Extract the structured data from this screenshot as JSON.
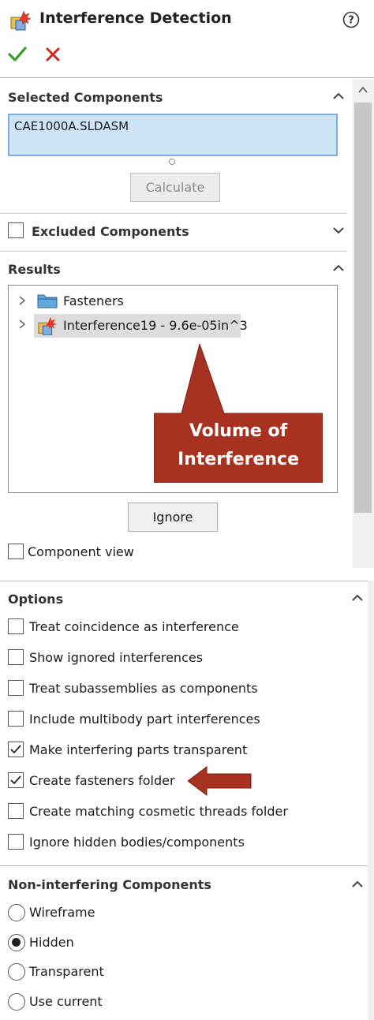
{
  "header": {
    "title": "Interference Detection",
    "help_icon": "help-circle-icon",
    "ok_icon": "checkmark-icon",
    "cancel_icon": "x-icon"
  },
  "selected_components": {
    "label": "Selected Components",
    "item": "CAE1000A.SLDASM",
    "calculate_label": "Calculate"
  },
  "excluded_components": {
    "label": "Excluded Components",
    "checked": false
  },
  "results": {
    "label": "Results",
    "tree": [
      {
        "label": "Fasteners",
        "icon": "folder-icon"
      },
      {
        "label": "Interference19 - 9.6e-05in^3",
        "icon": "interference-icon",
        "highlighted": true
      }
    ],
    "callout_line1": "Volume of",
    "callout_line2": "Interference",
    "ignore_label": "Ignore",
    "component_view_label": "Component view"
  },
  "options": {
    "label": "Options",
    "items": [
      {
        "label": "Treat coincidence as interference",
        "checked": false
      },
      {
        "label": "Show ignored interferences",
        "checked": false
      },
      {
        "label": "Treat subassemblies as components",
        "checked": false
      },
      {
        "label": "Include multibody part interferences",
        "checked": false
      },
      {
        "label": "Make interfering parts transparent",
        "checked": true
      },
      {
        "label": "Create fasteners folder",
        "checked": true
      },
      {
        "label": "Create matching cosmetic threads folder",
        "checked": false
      },
      {
        "label": "Ignore hidden bodies/components",
        "checked": false
      }
    ]
  },
  "non_interfering": {
    "label": "Non-interfering Components",
    "options": [
      {
        "label": "Wireframe",
        "selected": false
      },
      {
        "label": "Hidden",
        "selected": true
      },
      {
        "label": "Transparent",
        "selected": false
      },
      {
        "label": "Use current",
        "selected": false
      }
    ]
  },
  "colors": {
    "callout": "#a83220",
    "selection_box": "#cde4f7",
    "checkmark": "#3a9a2a",
    "x_mark": "#d0241c"
  }
}
